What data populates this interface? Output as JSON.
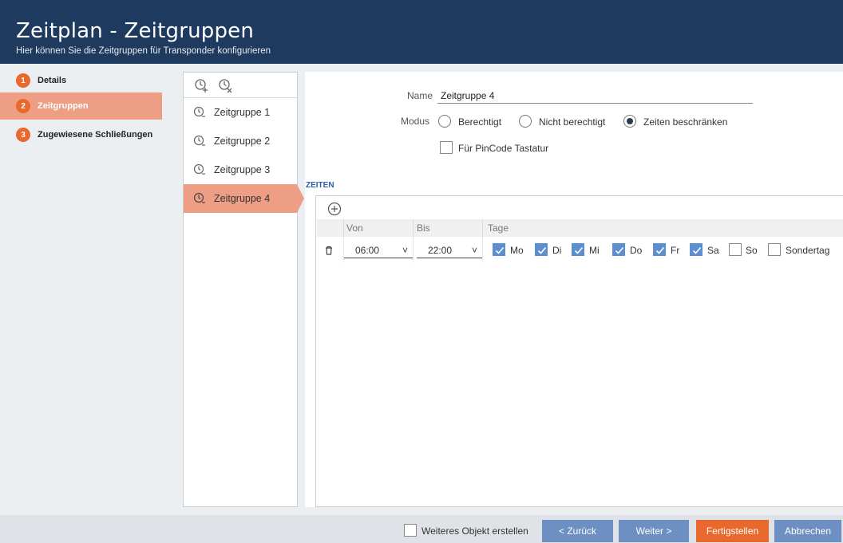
{
  "header": {
    "title": "Zeitplan - Zeitgruppen",
    "subtitle": "Hier können Sie die Zeitgruppen für Transponder konfigurieren"
  },
  "steps": [
    {
      "num": "1",
      "label": "Details",
      "active": false
    },
    {
      "num": "2",
      "label": "Zeitgruppen",
      "active": true
    },
    {
      "num": "3",
      "label": "Zugewiesene Schließungen",
      "active": false
    }
  ],
  "groups": [
    {
      "label": "Zeitgruppe 1",
      "active": false
    },
    {
      "label": "Zeitgruppe 2",
      "active": false
    },
    {
      "label": "Zeitgruppe 3",
      "active": false
    },
    {
      "label": "Zeitgruppe 4",
      "active": true
    }
  ],
  "form": {
    "name_label": "Name",
    "name_value": "Zeitgruppe 4",
    "modus_label": "Modus",
    "modus_options": [
      {
        "label": "Berechtigt",
        "selected": false
      },
      {
        "label": "Nicht berechtigt",
        "selected": false
      },
      {
        "label": "Zeiten beschränken",
        "selected": true
      }
    ],
    "pincode_label": "Für PinCode Tastatur",
    "pincode_checked": false
  },
  "zeiten": {
    "heading": "ZEITEN",
    "columns": [
      "Von",
      "Bis",
      "Tage"
    ],
    "rows": [
      {
        "von": "06:00",
        "bis": "22:00",
        "days": [
          {
            "label": "Mo",
            "checked": true
          },
          {
            "label": "Di",
            "checked": true
          },
          {
            "label": "Mi",
            "checked": true
          },
          {
            "label": "Do",
            "checked": true
          },
          {
            "label": "Fr",
            "checked": true
          },
          {
            "label": "Sa",
            "checked": true
          },
          {
            "label": "So",
            "checked": false
          },
          {
            "label": "Sondertag",
            "checked": false
          }
        ]
      }
    ]
  },
  "footer": {
    "weiteres_label": "Weiteres Objekt erstellen",
    "weiteres_checked": false,
    "back": "< Zurück",
    "next": "Weiter >",
    "finish": "Fertigstellen",
    "cancel": "Abbrechen"
  },
  "icons": {
    "dropdown": "˅",
    "clock": "clock-icon",
    "add": "add-circle-icon",
    "delete": "trash-icon"
  },
  "colors": {
    "header": "#1f3a5f",
    "accent_orange": "#e9682d",
    "active_bg": "#ef9e86",
    "checkbox_blue": "#5b8fd0",
    "button_blue": "#6d8fc2"
  }
}
